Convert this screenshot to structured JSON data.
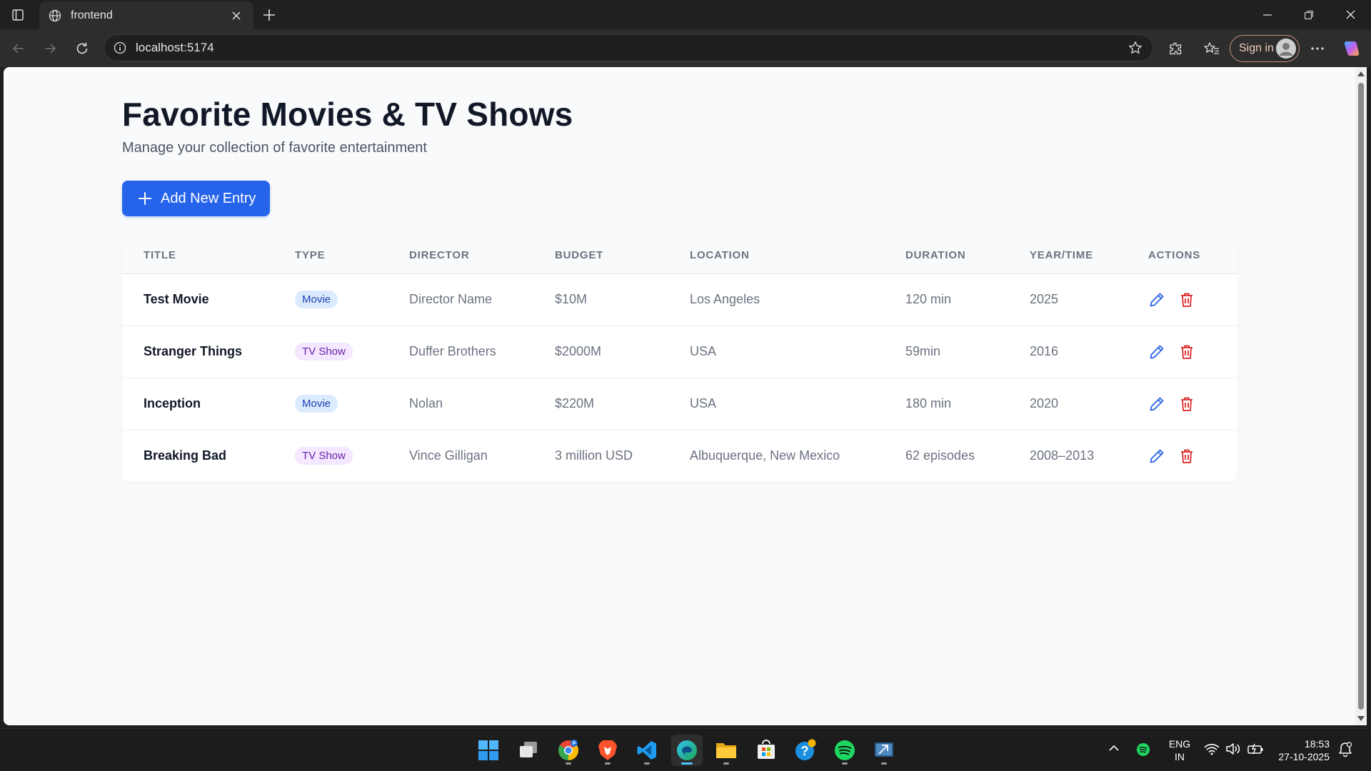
{
  "browser": {
    "tab_title": "frontend",
    "url": "localhost:5174",
    "sign_in_label": "Sign in"
  },
  "page": {
    "title": "Favorite Movies & TV Shows",
    "subtitle": "Manage your collection of favorite entertainment",
    "add_button_label": "Add New Entry"
  },
  "table": {
    "headers": [
      "TITLE",
      "TYPE",
      "DIRECTOR",
      "BUDGET",
      "LOCATION",
      "DURATION",
      "YEAR/TIME",
      "ACTIONS"
    ],
    "rows": [
      {
        "title": "Test Movie",
        "type": "Movie",
        "director": "Director Name",
        "budget": "$10M",
        "location": "Los Angeles",
        "duration": "120 min",
        "year": "2025"
      },
      {
        "title": "Stranger Things",
        "type": "TV Show",
        "director": "Duffer Brothers",
        "budget": "$2000M",
        "location": "USA",
        "duration": "59min",
        "year": "2016"
      },
      {
        "title": "Inception",
        "type": "Movie",
        "director": "Nolan",
        "budget": "$220M",
        "location": "USA",
        "duration": "180 min",
        "year": "2020"
      },
      {
        "title": "Breaking Bad",
        "type": "TV Show",
        "director": "Vince Gilligan",
        "budget": "3 million USD",
        "location": "Albuquerque, New Mexico",
        "duration": "62 episodes",
        "year": "2008–2013"
      }
    ]
  },
  "colors": {
    "primary": "#2563eb",
    "edit_icon": "#2563eb",
    "delete_icon": "#dc2626",
    "movie_badge_bg": "#dbeafe",
    "tv_badge_bg": "#f3e8ff"
  },
  "taskbar": {
    "apps": [
      "start-icon",
      "task-view-icon",
      "chrome-icon",
      "brave-icon",
      "vscode-icon",
      "edge-icon",
      "file-explorer-icon",
      "store-icon",
      "help-icon",
      "spotify-icon",
      "remote-desktop-icon"
    ],
    "language_line1": "ENG",
    "language_line2": "IN",
    "time": "18:53",
    "date": "27-10-2025"
  }
}
